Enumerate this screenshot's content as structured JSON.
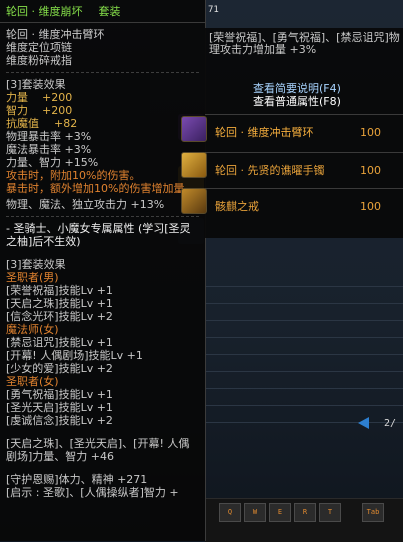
{
  "window": {
    "level_badge": "71",
    "page_indicator": "2/"
  },
  "keybar": {
    "keys": [
      "Q",
      "W",
      "E",
      "R",
      "T",
      "Tab"
    ]
  },
  "tooltip_left": {
    "title": "轮回 · 维度崩坏",
    "tag": "套装",
    "parts": [
      "轮回 · 维度冲击臂环",
      "维度定位项链",
      "维度粉碎戒指"
    ],
    "set3_header": "[3]套装效果",
    "set3_stats": [
      {
        "label": "力量",
        "value": "+200"
      },
      {
        "label": "智力",
        "value": "+200"
      },
      {
        "label": "抗魔值",
        "value": "+82"
      }
    ],
    "set3_crit": [
      "物理暴击率 +3%",
      "魔法暴击率 +3%",
      "力量、智力 +15%"
    ],
    "set3_special": [
      "攻击时，附加10%的伤害。",
      "暴击时，额外增加10%的伤害增加量。"
    ],
    "set3_attack": "物理、魔法、独立攻击力 +13%",
    "class_header": "- 圣骑士、小魔女专属属性 (学习[圣灵之柚]后不生效)",
    "class_set_header": "[3]套装效果",
    "class_groups": [
      {
        "name": "圣职者(男)",
        "skills": [
          "[荣誉祝福]技能Lv +1",
          "[天启之珠]技能Lv +1",
          "[信念光环]技能Lv +2"
        ]
      },
      {
        "name": "魔法师(女)",
        "skills": [
          "[禁忌诅咒]技能Lv +1",
          "[开幕! 人偶剧场]技能Lv +1",
          "[少女的爱]技能Lv +2"
        ]
      },
      {
        "name": "圣职者(女)",
        "skills": [
          "[勇气祝福]技能Lv +1",
          "[圣光天启]技能Lv +1",
          "[虔诚信念]技能Lv +2"
        ]
      }
    ],
    "bottom_lines": [
      "[天启之珠]、[圣光天启]、[开幕! 人偶剧场]力量、智力 +46",
      "[守护恩赐]体力、精神 +271",
      "[启示 : 圣歌]、[人偶操纵者]智力 +"
    ]
  },
  "tooltip_right": {
    "desc": "[荣誉祝福]、[勇气祝福]、[禁忌诅咒]物理攻击力增加量 +3%",
    "link_simple": "查看简要说明(F4)",
    "link_normal": "查看普通属性(F8)",
    "items": [
      {
        "name": "轮回 · 维度冲击臂环",
        "value": "100"
      },
      {
        "name": "轮回 · 先贤的谯曜手镯",
        "value": "100"
      },
      {
        "name": "骸麒之戒",
        "value": "100"
      }
    ]
  }
}
